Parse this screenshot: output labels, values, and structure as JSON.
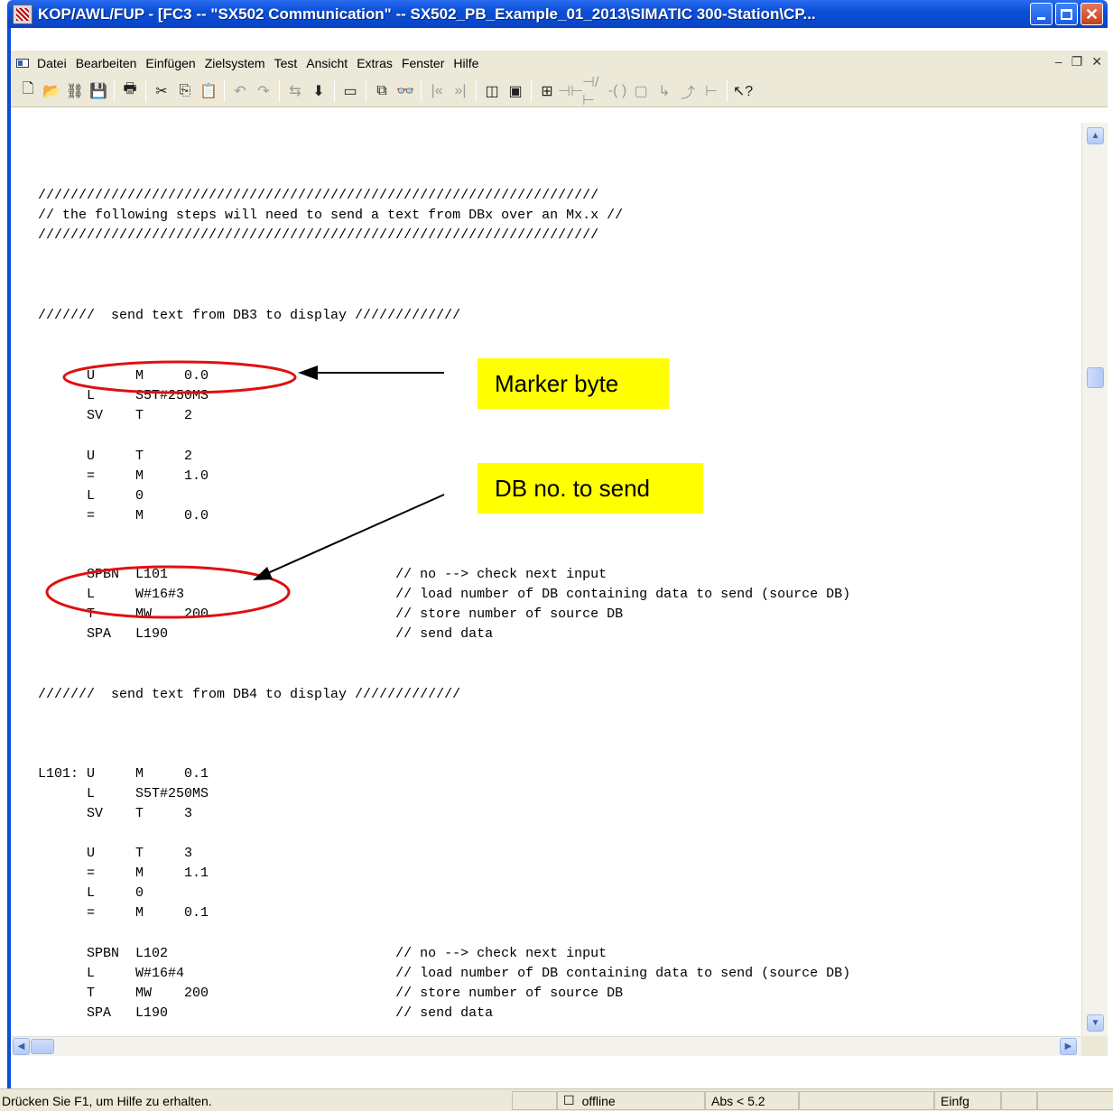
{
  "window": {
    "title": "KOP/AWL/FUP  - [FC3 -- \"SX502 Communication\" -- SX502_PB_Example_01_2013\\SIMATIC 300-Station\\CP..."
  },
  "menu": {
    "items": [
      "Datei",
      "Bearbeiten",
      "Einfügen",
      "Zielsystem",
      "Test",
      "Ansicht",
      "Extras",
      "Fenster",
      "Hilfe"
    ]
  },
  "code": {
    "lines": [
      "/////////////////////////////////////////////////////////////////////",
      "// the following steps will need to send a text from DBx over an Mx.x //",
      "/////////////////////////////////////////////////////////////////////",
      "///////  send text from DB3 to display /////////////",
      "      U     M     0.0",
      "      L     S5T#250MS",
      "      SV    T     2",
      "      U     T     2",
      "      =     M     1.0",
      "      L     0",
      "      =     M     0.0",
      "      SPBN  L101                            // no --> check next input",
      "      L     W#16#3                          // load number of DB containing data to send (source DB)",
      "      T     MW    200                       // store number of source DB",
      "      SPA   L190                            // send data",
      "///////  send text from DB4 to display /////////////",
      "L101: U     M     0.1",
      "      L     S5T#250MS",
      "      SV    T     3",
      "      U     T     3",
      "      =     M     1.1",
      "      L     0",
      "      =     M     0.1",
      "      SPBN  L102                            // no --> check next input",
      "      L     W#16#4                          // load number of DB containing data to send (source DB)",
      "      T     MW    200                       // store number of source DB",
      "      SPA   L190                            // send data"
    ]
  },
  "annotations": {
    "marker": "Marker byte",
    "dbno": "DB no. to send"
  },
  "status": {
    "help": "Drücken Sie F1, um Hilfe zu erhalten.",
    "mode": "offline",
    "abs": "Abs < 5.2",
    "insert": "Einfg"
  },
  "colors": {
    "title_bar": "#0a4fd8",
    "annotation_bg": "#ffff00",
    "annotation_ring": "#e01010"
  }
}
